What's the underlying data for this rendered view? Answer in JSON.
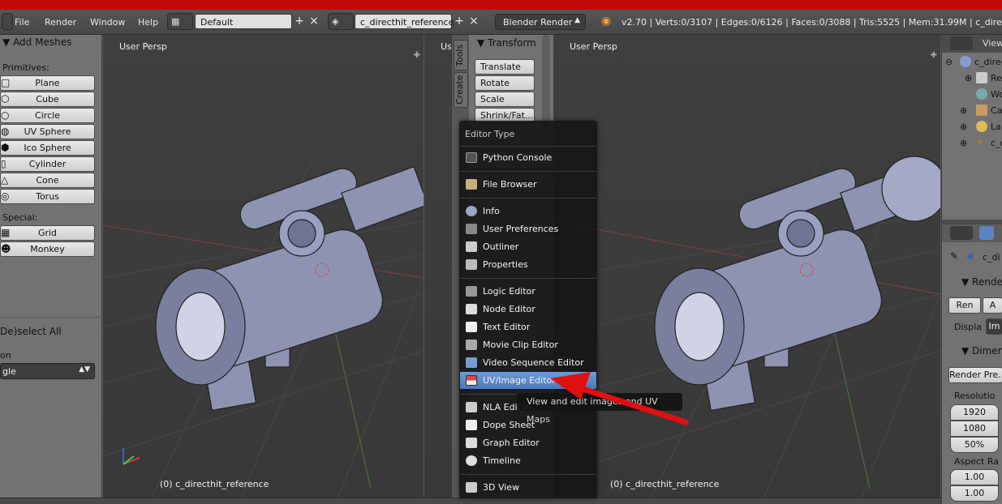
{
  "menubar": {
    "items": [
      "File",
      "Render",
      "Window",
      "Help"
    ],
    "screen_layout": "Default",
    "scene": "c_directhit_reference",
    "render_engine": "Blender Render",
    "stats": "v2.70 | Verts:0/3107 | Edges:0/6126 | Faces:0/3088 | Tris:5525 | Mem:31.99M | c_directhit_r"
  },
  "toolshelf": {
    "panel_title": "Add Meshes",
    "primitives_label": "Primitives:",
    "primitives": [
      "Plane",
      "Cube",
      "Circle",
      "UV Sphere",
      "Ico Sphere",
      "Cylinder",
      "Cone",
      "Torus"
    ],
    "special_label": "Special:",
    "special": [
      "Grid",
      "Monkey"
    ],
    "deselect_label": "De)select All",
    "operator_label": "on",
    "operator_value": "gle"
  },
  "viewports": {
    "left_label": "User Persp",
    "left_object": "(0) c_directhit_reference",
    "middle_label_partial": "Us",
    "right_label": "User Persp",
    "right_object": "(0) c_directhit_reference"
  },
  "npanel": {
    "tabs": [
      "Tools",
      "Create"
    ],
    "section": "Transform",
    "buttons": [
      "Translate",
      "Rotate",
      "Scale",
      "Shrink/Fat..."
    ]
  },
  "editor_menu": {
    "title": "Editor Type",
    "groups": [
      [
        {
          "label": "Python Console",
          "icon": "console-icon"
        }
      ],
      [
        {
          "label": "File Browser",
          "icon": "folder-icon"
        }
      ],
      [
        {
          "label": "Info",
          "icon": "info-icon"
        },
        {
          "label": "User Preferences",
          "icon": "preferences-icon"
        },
        {
          "label": "Outliner",
          "icon": "outliner-icon"
        },
        {
          "label": "Properties",
          "icon": "properties-icon"
        }
      ],
      [
        {
          "label": "Logic Editor",
          "icon": "logic-icon"
        },
        {
          "label": "Node Editor",
          "icon": "node-icon"
        },
        {
          "label": "Text Editor",
          "icon": "text-icon"
        },
        {
          "label": "Movie Clip Editor",
          "icon": "movie-clip-icon"
        },
        {
          "label": "Video Sequence Editor",
          "icon": "sequencer-icon"
        },
        {
          "label": "UV/Image Editor",
          "icon": "image-icon"
        }
      ],
      [
        {
          "label": "NLA Editor",
          "icon": "nla-icon"
        },
        {
          "label": "Dope Sheet",
          "icon": "dopesheet-icon"
        },
        {
          "label": "Graph Editor",
          "icon": "graph-icon"
        },
        {
          "label": "Timeline",
          "icon": "timeline-icon"
        }
      ],
      [
        {
          "label": "3D View",
          "icon": "cube-icon"
        }
      ]
    ],
    "highlighted": "UV/Image Editor",
    "tooltip": "View and edit images and UV Maps"
  },
  "outliner": {
    "view_label": "View",
    "rows": [
      "c_direc",
      "Re",
      "Wo",
      "Ca",
      "La",
      "c_d"
    ]
  },
  "properties": {
    "object_name": "c_di",
    "render_section": "Render",
    "render_btn": "Ren",
    "anim_btn": "A",
    "display_label": "Displa",
    "display_value": "Im",
    "dimensions_section": "Dimensio",
    "presets": "Render Pre...",
    "resolution_label": "Resolutio",
    "res_x": "1920",
    "res_y": "1080",
    "res_pct": "50%",
    "aspect_label": "Aspect Ra",
    "aspect_x": "1.00",
    "aspect_y": "1.00"
  },
  "colors": {
    "title_bar": "#c00a0a",
    "highlight": "#5a88c8",
    "arrow": "#e01010"
  }
}
